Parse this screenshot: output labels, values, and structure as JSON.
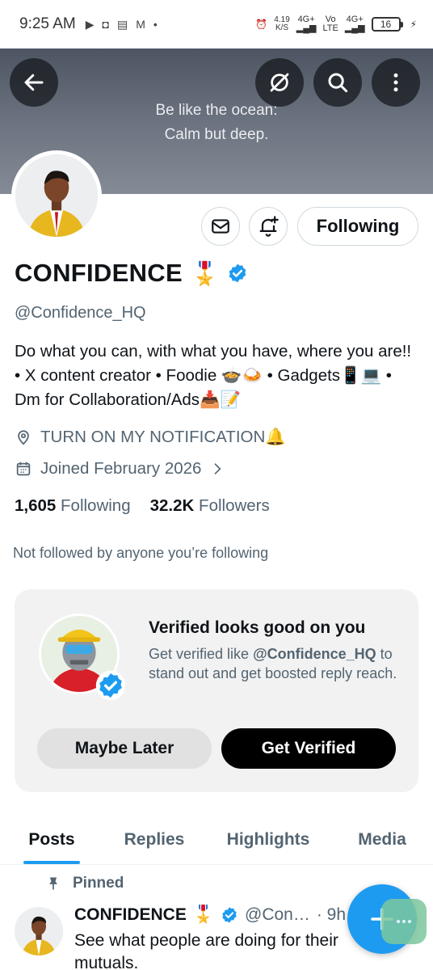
{
  "status_bar": {
    "time": "9:25 AM",
    "speed_value": "4.19",
    "speed_unit": "K/S",
    "net1_top": "4G+",
    "net2_top": "Vo",
    "net2_bottom": "LTE",
    "net3_top": "4G+",
    "battery": "16"
  },
  "banner": {
    "quote_line1": "Be like the ocean:",
    "quote_line2": "Calm but deep."
  },
  "profile": {
    "name": "CONFIDENCE",
    "name_emoji": "🎖️",
    "handle": "@Confidence_HQ",
    "bio": "Do what you can, with what you have, where you are!! • X content creator • Foodie 🍲🍛 • Gadgets📱💻 • Dm for Collaboration/Ads📥📝",
    "location": "TURN ON MY NOTIFICATION🔔",
    "joined": "Joined February 2026",
    "following_count": "1,605",
    "following_label": "Following",
    "followers_count": "32.2K",
    "followers_label": "Followers",
    "not_followed_text": "Not followed by anyone you’re following",
    "follow_button": "Following"
  },
  "verified_card": {
    "title": "Verified looks good on you",
    "desc_prefix": "Get verified like ",
    "desc_handle": "@Confidence_HQ",
    "desc_suffix": " to stand out and get boosted reply reach.",
    "maybe_later": "Maybe Later",
    "get_verified": "Get Verified"
  },
  "tabs": [
    "Posts",
    "Replies",
    "Highlights",
    "Media"
  ],
  "post": {
    "pinned_label": "Pinned",
    "author": "CONFIDENCE",
    "author_emoji": "🎖️",
    "handle": "@Con…",
    "time": "· 9h",
    "text_line1": "See what people are doing for their",
    "text_line2": "mutuals."
  },
  "colors": {
    "accent": "#1d9bf0",
    "muted_text": "#536471"
  }
}
